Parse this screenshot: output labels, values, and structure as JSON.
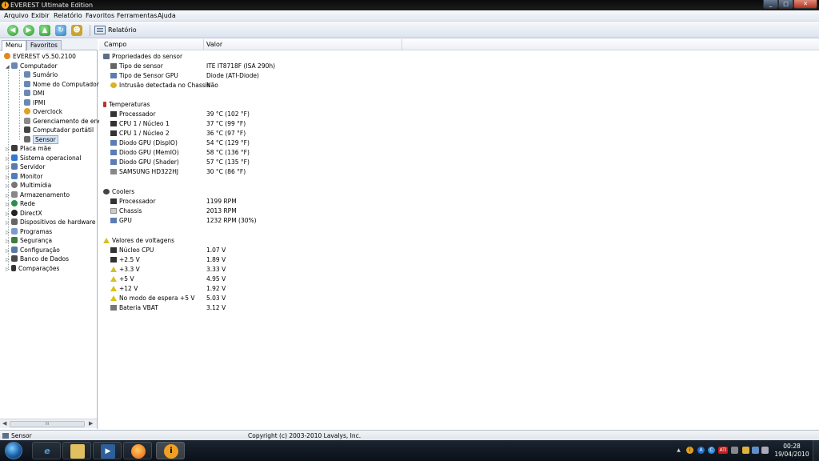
{
  "window": {
    "title": "EVEREST Ultimate Edition"
  },
  "menu": [
    "Arquivo",
    "Exibir",
    "Relatório",
    "Favoritos",
    "Ferramentas",
    "Ajuda"
  ],
  "toolbar": {
    "report_label": "Relatório"
  },
  "left_tabs": [
    "Menu",
    "Favoritos"
  ],
  "tree": {
    "root": "EVEREST v5.50.2100",
    "computador": "Computador",
    "children": [
      "Sumário",
      "Nome do Computador",
      "DMI",
      "IPMI",
      "Overclock",
      "Gerenciamento de energ",
      "Computador portátil",
      "Sensor"
    ],
    "top": [
      "Placa mãe",
      "Sistema operacional",
      "Servidor",
      "Monitor",
      "Multimídia",
      "Armazenamento",
      "Rede",
      "DirectX",
      "Dispositivos de hardware",
      "Programas",
      "Segurança",
      "Configuração",
      "Banco de Dados",
      "Comparações"
    ]
  },
  "columns": {
    "campo": "Campo",
    "valor": "Valor"
  },
  "sections": [
    {
      "title": "Propriedades do sensor",
      "rows": [
        {
          "field": "Tipo de sensor",
          "value": "ITE IT8718F  (ISA 290h)"
        },
        {
          "field": "Tipo de Sensor GPU",
          "value": "Diode  (ATI-Diode)"
        },
        {
          "field": "Intrusão detectada no Chassis",
          "value": "Não"
        }
      ]
    },
    {
      "title": "Temperaturas",
      "rows": [
        {
          "field": "Processador",
          "value": "39 °C  (102 °F)"
        },
        {
          "field": "CPU 1 / Núcleo 1",
          "value": "37 °C  (99 °F)"
        },
        {
          "field": "CPU 1 / Núcleo 2",
          "value": "36 °C  (97 °F)"
        },
        {
          "field": "Diodo GPU (DispIO)",
          "value": "54 °C  (129 °F)"
        },
        {
          "field": "Diodo GPU (MemIO)",
          "value": "58 °C  (136 °F)"
        },
        {
          "field": "Diodo GPU (Shader)",
          "value": "57 °C  (135 °F)"
        },
        {
          "field": "SAMSUNG HD322HJ",
          "value": "30 °C  (86 °F)"
        }
      ]
    },
    {
      "title": "Coolers",
      "rows": [
        {
          "field": "Processador",
          "value": "1199 RPM"
        },
        {
          "field": "Chassis",
          "value": "2013 RPM"
        },
        {
          "field": "GPU",
          "value": "1232 RPM  (30%)"
        }
      ]
    },
    {
      "title": "Valores de voltagens",
      "rows": [
        {
          "field": "Núcleo CPU",
          "value": "1.07 V"
        },
        {
          "field": "+2.5 V",
          "value": "1.89 V"
        },
        {
          "field": "+3.3 V",
          "value": "3.33 V"
        },
        {
          "field": "+5 V",
          "value": "4.95 V"
        },
        {
          "field": "+12 V",
          "value": "1.92 V"
        },
        {
          "field": "No modo de espera +5 V",
          "value": "5.03 V"
        },
        {
          "field": "Bateria VBAT",
          "value": "3.12 V"
        }
      ]
    }
  ],
  "status": {
    "left": "Sensor",
    "copyright": "Copyright (c) 2003-2010 Lavalys, Inc."
  },
  "clock": {
    "time": "00:28",
    "date": "19/04/2010"
  },
  "tray_labels": [
    "A",
    "C",
    "ATI"
  ]
}
